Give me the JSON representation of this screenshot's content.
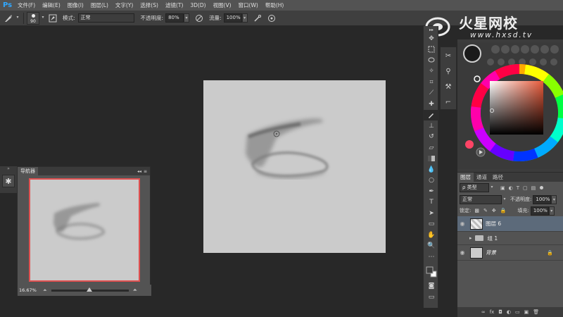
{
  "app": {
    "logo": "Ps"
  },
  "menu": [
    "文件(F)",
    "编辑(E)",
    "图像(I)",
    "图层(L)",
    "文字(Y)",
    "选择(S)",
    "滤镜(T)",
    "3D(D)",
    "视图(V)",
    "窗口(W)",
    "帮助(H)"
  ],
  "options": {
    "brush_size": "90",
    "mode_label": "模式:",
    "mode_value": "正常",
    "opacity_label": "不透明度:",
    "opacity_value": "80%",
    "flow_label": "流量:",
    "flow_value": "100%"
  },
  "navigator": {
    "title": "导航器",
    "zoom": "16.67%"
  },
  "layers": {
    "tabs": [
      "图层",
      "通道",
      "路径"
    ],
    "filter_kind": "ρ 类型",
    "blend_mode": "正常",
    "opacity_label": "不透明度:",
    "opacity_value": "100%",
    "lock_label": "锁定:",
    "fill_label": "填充:",
    "fill_value": "100%",
    "items": [
      {
        "name": "图层 6",
        "type": "layer"
      },
      {
        "name": "组 1",
        "type": "group"
      },
      {
        "name": "背景",
        "type": "background"
      }
    ]
  },
  "watermark": {
    "title": "火星网校",
    "url": "www.hxsd.tv"
  },
  "colors": {
    "accent": "#31a8ff",
    "canvas": "#cbcbcb",
    "nav_frame": "#e05050"
  }
}
